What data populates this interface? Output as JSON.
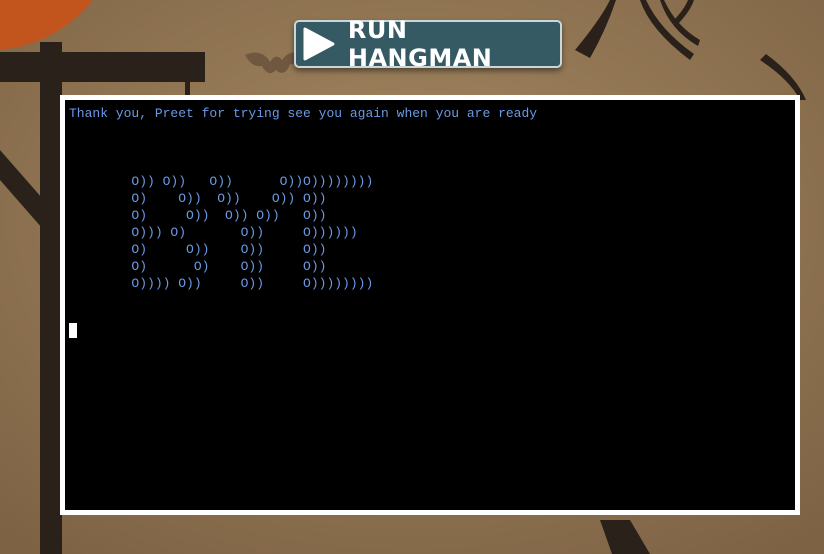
{
  "run_button": {
    "label": "RUN HANGMAN",
    "icon": "play-icon"
  },
  "terminal": {
    "message": "Thank you, Preet for trying see you again when you are ready",
    "ascii_art": [
      "        O)) O))   O))      O))O))))))))",
      "        O)    O))  O))    O)) O))",
      "        O)     O))  O)) O))   O))",
      "        O))) O)       O))     O))))))",
      "        O)     O))    O))     O))",
      "        O)      O)    O))     O))",
      "        O)))) O))     O))     O))))))))"
    ],
    "text_color": "#6a9ae6",
    "background": "#000000"
  },
  "colors": {
    "button_bg": "#365a64",
    "background_sky": "#8a6f4e",
    "moon": "#c2551e",
    "silhouette": "#2b211b"
  }
}
